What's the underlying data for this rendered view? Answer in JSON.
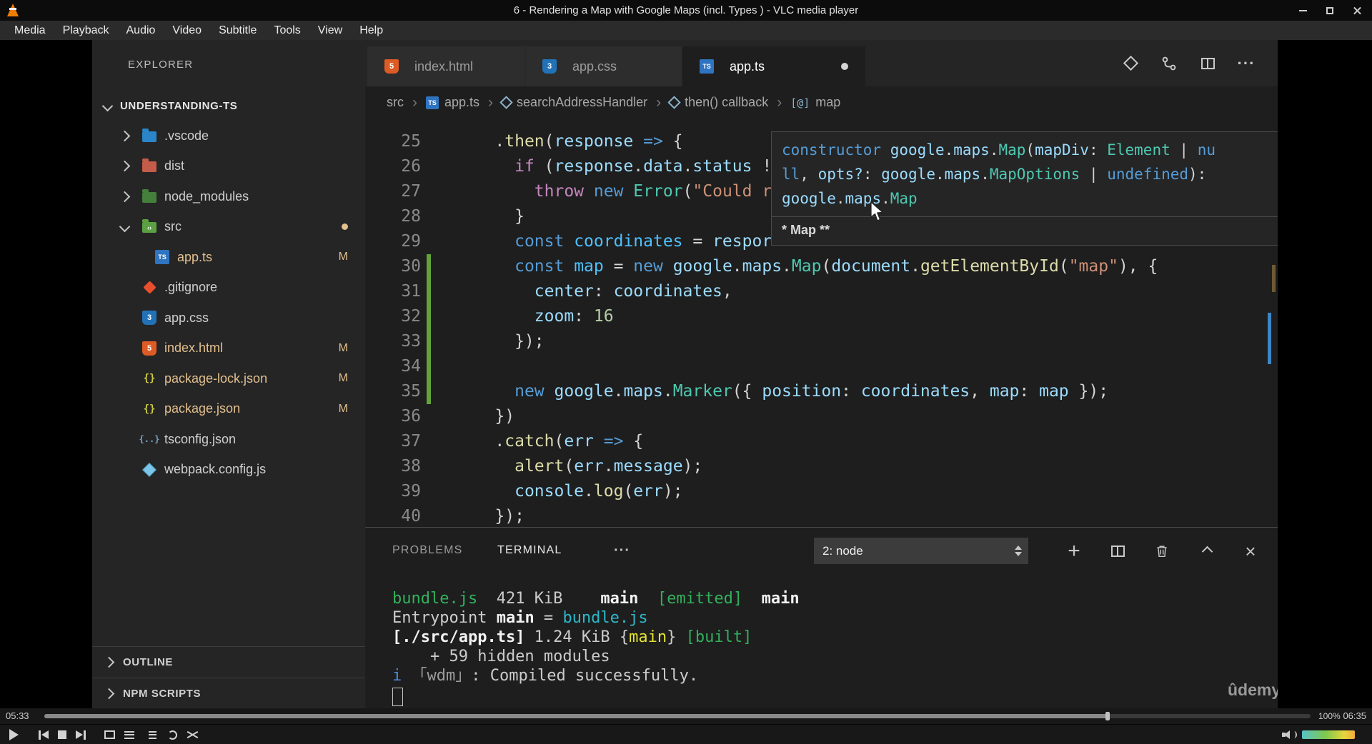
{
  "vlc": {
    "window_title": "6 - Rendering a Map with Google Maps (incl. Types ) - VLC media player",
    "menu_items": [
      "Media",
      "Playback",
      "Audio",
      "Video",
      "Subtitle",
      "Tools",
      "View",
      "Help"
    ],
    "time_elapsed": "05:33",
    "time_total": "06:35",
    "progress_percent": 84,
    "volume_label": "100%"
  },
  "icons": {
    "ts": "TS",
    "css": "3",
    "html": "5",
    "json": "{}",
    "json2": "{..}",
    "folder-src": "‹›",
    "symbol-array": "[@]",
    "breadcrumb_separator": "›",
    "more": "···",
    "ellipsis": "···",
    "plus": "+",
    "close": "×"
  },
  "vscode": {
    "explorer": {
      "title": "EXPLORER",
      "project": "UNDERSTANDING-TS",
      "modified_badge": "M",
      "tree": [
        {
          "label": ".vscode",
          "icon": "folder-vscode",
          "folder": true,
          "chevron": "right"
        },
        {
          "label": "dist",
          "icon": "folder-dist",
          "folder": true,
          "chevron": "right"
        },
        {
          "label": "node_modules",
          "icon": "folder-node",
          "folder": true,
          "chevron": "right"
        },
        {
          "label": "src",
          "icon": "folder-src",
          "folder": true,
          "chevron": "down",
          "badge": "dot"
        },
        {
          "label": "app.ts",
          "icon": "ts",
          "level": 1,
          "badge": "M",
          "modified": true
        },
        {
          "label": ".gitignore",
          "icon": "git"
        },
        {
          "label": "app.css",
          "icon": "css"
        },
        {
          "label": "index.html",
          "icon": "html",
          "badge": "M",
          "modified": true
        },
        {
          "label": "package-lock.json",
          "icon": "json",
          "badge": "M",
          "modified": true
        },
        {
          "label": "package.json",
          "icon": "json",
          "badge": "M",
          "modified": true
        },
        {
          "label": "tsconfig.json",
          "icon": "json2"
        },
        {
          "label": "webpack.config.js",
          "icon": "webpack"
        }
      ],
      "bottom_sections": [
        "OUTLINE",
        "NPM SCRIPTS"
      ]
    },
    "tabs": [
      {
        "label": "index.html",
        "icon": "html"
      },
      {
        "label": "app.css",
        "icon": "css"
      },
      {
        "label": "app.ts",
        "icon": "ts",
        "active": true,
        "dirty": true
      }
    ],
    "breadcrumbs": [
      {
        "label": "src"
      },
      {
        "label": "app.ts",
        "icon": "ts"
      },
      {
        "label": "searchAddressHandler",
        "icon": "symbol-method"
      },
      {
        "label": "then() callback",
        "icon": "symbol-method"
      },
      {
        "label": "map",
        "icon": "symbol-array"
      }
    ],
    "code": {
      "lines": [
        {
          "n": 25,
          "t": [
            [
              "pun",
              "    ."
            ],
            [
              "fn",
              "then"
            ],
            [
              "pun",
              "("
            ],
            [
              "var",
              "response"
            ],
            [
              "pun",
              " "
            ],
            [
              "kw",
              "=>"
            ],
            [
              "pun",
              " {"
            ]
          ]
        },
        {
          "n": 26,
          "t": [
            [
              "pun",
              "      "
            ],
            [
              "ctrl",
              "if"
            ],
            [
              "pun",
              " ("
            ],
            [
              "var",
              "response"
            ],
            [
              "pun",
              "."
            ],
            [
              "var",
              "data"
            ],
            [
              "pun",
              "."
            ],
            [
              "var",
              "status"
            ],
            [
              "pun",
              " !"
            ]
          ]
        },
        {
          "n": 27,
          "t": [
            [
              "pun",
              "        "
            ],
            [
              "ctrl",
              "throw"
            ],
            [
              "pun",
              " "
            ],
            [
              "kw",
              "new"
            ],
            [
              "pun",
              " "
            ],
            [
              "type",
              "Error"
            ],
            [
              "pun",
              "("
            ],
            [
              "str",
              "\"Could r"
            ]
          ]
        },
        {
          "n": 28,
          "t": [
            [
              "pun",
              "      }"
            ]
          ]
        },
        {
          "n": 29,
          "t": [
            [
              "pun",
              "      "
            ],
            [
              "kw",
              "const"
            ],
            [
              "pun",
              " "
            ],
            [
              "cv",
              "coordinates"
            ],
            [
              "pun",
              " = "
            ],
            [
              "var",
              "respor"
            ]
          ]
        },
        {
          "n": 30,
          "mod": true,
          "t": [
            [
              "pun",
              "      "
            ],
            [
              "kw",
              "const"
            ],
            [
              "pun",
              " "
            ],
            [
              "cv",
              "map"
            ],
            [
              "pun",
              " = "
            ],
            [
              "kw",
              "new"
            ],
            [
              "pun",
              " "
            ],
            [
              "var",
              "google"
            ],
            [
              "pun",
              "."
            ],
            [
              "var",
              "maps"
            ],
            [
              "pun",
              "."
            ],
            [
              "type",
              "Map"
            ],
            [
              "pun",
              "("
            ],
            [
              "var",
              "document"
            ],
            [
              "pun",
              "."
            ],
            [
              "fn",
              "getElementById"
            ],
            [
              "pun",
              "("
            ],
            [
              "str",
              "\"map\""
            ],
            [
              "pun",
              "), {"
            ]
          ]
        },
        {
          "n": 31,
          "mod": true,
          "t": [
            [
              "pun",
              "        "
            ],
            [
              "var",
              "center"
            ],
            [
              "pun",
              ": "
            ],
            [
              "var",
              "coordinates"
            ],
            [
              "pun",
              ","
            ]
          ]
        },
        {
          "n": 32,
          "mod": true,
          "t": [
            [
              "pun",
              "        "
            ],
            [
              "var",
              "zoom"
            ],
            [
              "pun",
              ": "
            ],
            [
              "num",
              "16"
            ]
          ]
        },
        {
          "n": 33,
          "mod": true,
          "t": [
            [
              "pun",
              "      });"
            ]
          ]
        },
        {
          "n": 34,
          "mod": true,
          "t": []
        },
        {
          "n": 35,
          "mod": true,
          "t": [
            [
              "pun",
              "      "
            ],
            [
              "kw",
              "new"
            ],
            [
              "pun",
              " "
            ],
            [
              "var",
              "google"
            ],
            [
              "pun",
              "."
            ],
            [
              "var",
              "maps"
            ],
            [
              "pun",
              "."
            ],
            [
              "type",
              "Marker"
            ],
            [
              "pun",
              "({ "
            ],
            [
              "var",
              "position"
            ],
            [
              "pun",
              ": "
            ],
            [
              "var",
              "coordinates"
            ],
            [
              "pun",
              ", "
            ],
            [
              "var",
              "map"
            ],
            [
              "pun",
              ": "
            ],
            [
              "var",
              "map"
            ],
            [
              "pun",
              " });"
            ]
          ]
        },
        {
          "n": 36,
          "t": [
            [
              "pun",
              "    })"
            ]
          ]
        },
        {
          "n": 37,
          "t": [
            [
              "pun",
              "    ."
            ],
            [
              "fn",
              "catch"
            ],
            [
              "pun",
              "("
            ],
            [
              "var",
              "err"
            ],
            [
              "pun",
              " "
            ],
            [
              "kw",
              "=>"
            ],
            [
              "pun",
              " {"
            ]
          ]
        },
        {
          "n": 38,
          "t": [
            [
              "pun",
              "      "
            ],
            [
              "fn",
              "alert"
            ],
            [
              "pun",
              "("
            ],
            [
              "var",
              "err"
            ],
            [
              "pun",
              "."
            ],
            [
              "var",
              "message"
            ],
            [
              "pun",
              ");"
            ]
          ]
        },
        {
          "n": 39,
          "t": [
            [
              "pun",
              "      "
            ],
            [
              "var",
              "console"
            ],
            [
              "pun",
              "."
            ],
            [
              "fn",
              "log"
            ],
            [
              "pun",
              "("
            ],
            [
              "var",
              "err"
            ],
            [
              "pun",
              ");"
            ]
          ]
        },
        {
          "n": 40,
          "t": [
            [
              "pun",
              "    });"
            ]
          ]
        }
      ]
    },
    "tooltip": {
      "lines": [
        [
          [
            "kw",
            "constructor"
          ],
          [
            "pun",
            " "
          ],
          [
            "var",
            "google"
          ],
          [
            "pun",
            "."
          ],
          [
            "var",
            "maps"
          ],
          [
            "pun",
            "."
          ],
          [
            "type",
            "Map"
          ],
          [
            "pun",
            "("
          ],
          [
            "var",
            "mapDiv"
          ],
          [
            "pun",
            ": "
          ],
          [
            "type",
            "Element"
          ],
          [
            "pun",
            " | "
          ],
          [
            "kw",
            "nu"
          ]
        ],
        [
          [
            "kw",
            "ll"
          ],
          [
            "pun",
            ", "
          ],
          [
            "var",
            "opts?"
          ],
          [
            "pun",
            ": "
          ],
          [
            "var",
            "google"
          ],
          [
            "pun",
            "."
          ],
          [
            "var",
            "maps"
          ],
          [
            "pun",
            "."
          ],
          [
            "type",
            "MapOptions"
          ],
          [
            "pun",
            " | "
          ],
          [
            "kw",
            "undefined"
          ],
          [
            "pun",
            "): "
          ]
        ],
        [
          [
            "var",
            "google"
          ],
          [
            "pun",
            "."
          ],
          [
            "var",
            "maps"
          ],
          [
            "pun",
            "."
          ],
          [
            "type",
            "Map"
          ]
        ]
      ],
      "md": "* Map **"
    },
    "panel": {
      "tabs": [
        "PROBLEMS",
        "TERMINAL"
      ],
      "dropdown_value": "2: node",
      "terminal_lines": [
        [
          [
            "tgreen",
            "bundle.js"
          ],
          [
            "t",
            "  421 KiB    "
          ],
          [
            "tbold",
            "main"
          ],
          [
            "t",
            "  "
          ],
          [
            "tgreen",
            "[emitted]"
          ],
          [
            "t",
            "  "
          ],
          [
            "tbold",
            "main"
          ]
        ],
        [
          [
            "t",
            "Entrypoint "
          ],
          [
            "tbold",
            "main"
          ],
          [
            "t",
            " = "
          ],
          [
            "tcyan",
            "bundle.js"
          ]
        ],
        [
          [
            "tbold",
            "[./src/app.ts]"
          ],
          [
            "t",
            " 1.24 KiB "
          ],
          [
            "t",
            "{"
          ],
          [
            "tyellow",
            "main"
          ],
          [
            "t",
            "} "
          ],
          [
            "tgreen",
            "[built]"
          ]
        ],
        [
          [
            "t",
            "    + 59 hidden modules"
          ]
        ],
        [
          [
            "tblue",
            "i"
          ],
          [
            "t",
            " "
          ],
          [
            "tgray",
            "「wdm」"
          ],
          [
            "t",
            ": Compiled successfully."
          ]
        ]
      ]
    },
    "watermark": "ûdemy"
  }
}
